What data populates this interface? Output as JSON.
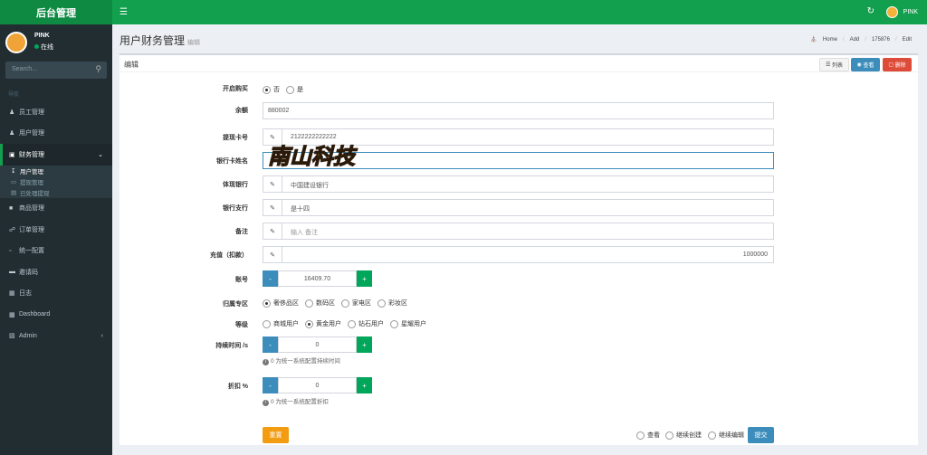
{
  "app": {
    "title": "后台管理"
  },
  "topbar": {
    "username": "PINK"
  },
  "user": {
    "name": "PINK",
    "status": "在线"
  },
  "search": {
    "placeholder": "Search..."
  },
  "nav": {
    "header": "导航",
    "items": [
      {
        "label": "员工管理",
        "icon": "user-icon"
      },
      {
        "label": "用户管理",
        "icon": "user-icon"
      },
      {
        "label": "财务管理",
        "icon": "bank-icon"
      }
    ],
    "sub": [
      {
        "label": "用户管理",
        "icon": "download-icon"
      },
      {
        "label": "提现管理",
        "icon": "card-icon"
      },
      {
        "label": "已处理提现",
        "icon": "file-icon"
      }
    ],
    "items2": [
      {
        "label": "商品管理",
        "icon": "box-icon"
      },
      {
        "label": "订单管理",
        "icon": "cart-icon"
      },
      {
        "label": "统一配置",
        "icon": "monitor-icon"
      },
      {
        "label": "邀请码",
        "icon": "ticket-icon"
      },
      {
        "label": "日志",
        "icon": "log-icon"
      },
      {
        "label": "Dashboard",
        "icon": "chart-icon"
      },
      {
        "label": "Admin",
        "icon": "admin-icon"
      }
    ]
  },
  "page": {
    "title": "用户财务管理",
    "subtitle": "编辑",
    "breadcrumb": [
      "Home",
      "Add",
      "175876",
      "Edit"
    ]
  },
  "box": {
    "title": "编辑",
    "btn_list": "列表",
    "btn_view": "查看",
    "btn_delete": "删除"
  },
  "form": {
    "purchase": {
      "label": "开启购买",
      "options": [
        "否",
        "是"
      ],
      "selected": 0
    },
    "balance": {
      "label": "余额",
      "value": "880002"
    },
    "card": {
      "label": "提现卡号",
      "value": "2122222222222"
    },
    "holder": {
      "label": "银行卡姓名",
      "value": ""
    },
    "bank": {
      "label": "体现银行",
      "value": "中国建设银行"
    },
    "branch": {
      "label": "银行支行",
      "value": "是十四"
    },
    "note": {
      "label": "备注",
      "placeholder": "输入 备注"
    },
    "recharge": {
      "label": "充值（扣款）",
      "value": "1000000"
    },
    "account": {
      "label": "账号",
      "value": "16409.70"
    },
    "zone": {
      "label": "归属专区",
      "options": [
        "奢侈品区",
        "数码区",
        "家电区",
        "彩妆区"
      ],
      "selected": 0
    },
    "level": {
      "label": "等级",
      "options": [
        "商城用户",
        "黄金用户",
        "钻石用户",
        "星耀用户"
      ],
      "selected": 1
    },
    "duration": {
      "label": "持续时间 /s",
      "value": "0",
      "help": "0 为统一系统配置持续时间"
    },
    "discount": {
      "label": "折扣 %",
      "value": "0",
      "help": "0 为统一系统配置折扣"
    }
  },
  "footer": {
    "reset": "重置",
    "view": "查看",
    "continue_create": "继续创建",
    "continue_edit": "继续编辑",
    "submit": "提交"
  },
  "watermark": {
    "text": "南山科技"
  },
  "colors": {
    "brand": "#12a04e",
    "sidebar": "#222d32",
    "primary": "#3c8dbc",
    "success": "#00a65a",
    "danger": "#dd4b39",
    "warning": "#f39c12"
  }
}
